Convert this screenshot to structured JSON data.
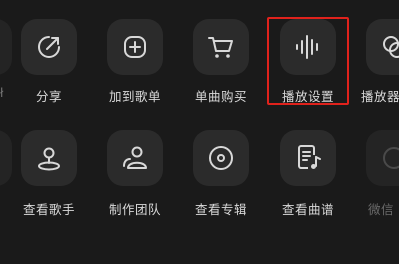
{
  "menu": {
    "row1": [
      {
        "label": "分享",
        "icon": "share-icon"
      },
      {
        "label": "加到歌单",
        "icon": "add-to-playlist-icon"
      },
      {
        "label": "单曲购买",
        "icon": "cart-icon"
      },
      {
        "label": "播放设置",
        "icon": "audio-wave-icon",
        "highlighted": true
      },
      {
        "label": "播放器",
        "icon": "player-skin-icon"
      }
    ],
    "row2": [
      {
        "label": "查看歌手",
        "icon": "singer-icon"
      },
      {
        "label": "制作团队",
        "icon": "team-icon"
      },
      {
        "label": "查看专辑",
        "icon": "album-icon"
      },
      {
        "label": "查看曲谱",
        "icon": "sheet-music-icon"
      },
      {
        "label": "微信",
        "icon": "wechat-icon",
        "disabled": true
      }
    ]
  },
  "colors": {
    "background": "#1a1a1a",
    "tile": "#2b2b2b",
    "icon": "#d8d8d8",
    "highlight_border": "#e0221c"
  }
}
